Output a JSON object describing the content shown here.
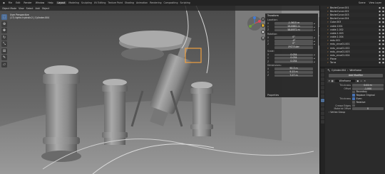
{
  "topbar": {
    "menus": [
      "File",
      "Edit",
      "Render",
      "Window",
      "Help"
    ],
    "workspaces": [
      "Layout",
      "Modeling",
      "Sculpting",
      "UV Editing",
      "Texture Paint",
      "Shading",
      "Animation",
      "Rendering",
      "Compositing",
      "Scripting"
    ],
    "active_workspace": "Layout",
    "scene": "Scene",
    "view_layer": "View Layer"
  },
  "viewport": {
    "mode": "Object Mode",
    "menus": [
      "View",
      "Select",
      "Add",
      "Object"
    ],
    "info_line1": "User Perspective",
    "info_line2": "(17) lights hydrolic2 | Cylinder.004",
    "background_color": "#5d5d5d"
  },
  "npanel": {
    "title": "Transform",
    "location_label": "Location:",
    "location": [
      {
        "axis": "X",
        "value": "-1.5615 m"
      },
      {
        "axis": "Y",
        "value": "28.6681 m"
      },
      {
        "axis": "Z",
        "value": "58.8971 m"
      }
    ],
    "rotation_label": "Rotation:",
    "rotation": [
      {
        "axis": "X",
        "value": "0°"
      },
      {
        "axis": "Y",
        "value": "-0°"
      },
      {
        "axis": "Z",
        "value": "0°"
      }
    ],
    "mode": "XYZ Euler",
    "scale_label": "Scale:",
    "scale": [
      {
        "axis": "X",
        "value": "0.034"
      },
      {
        "axis": "Y",
        "value": "0.034"
      },
      {
        "axis": "Z",
        "value": "0.034"
      }
    ],
    "dimensions_label": "Dimensions:",
    "dimensions": [
      {
        "axis": "X",
        "value": "90.3 m"
      },
      {
        "axis": "Y",
        "value": "9.15 m"
      },
      {
        "axis": "Z",
        "value": "7.07 m"
      }
    ],
    "footer": "Properties"
  },
  "outliner": {
    "rows": [
      {
        "name": "BezierCurve.001"
      },
      {
        "name": "BezierCurve.002"
      },
      {
        "name": "BezierCurve.003"
      },
      {
        "name": "BezierCurve.004"
      },
      {
        "name": "Cube.003"
      },
      {
        "name": "cable.1001"
      },
      {
        "name": "cable.1.002"
      },
      {
        "name": "cable.1.003"
      },
      {
        "name": "cable.1.004"
      },
      {
        "name": "mdu.001"
      },
      {
        "name": "mdu_circa01.001"
      },
      {
        "name": "mdu_circa01.002"
      },
      {
        "name": "mdu_circa01.003"
      },
      {
        "name": "mdu_circa01.004"
      },
      {
        "name": "Plane"
      },
      {
        "name": "Torus"
      }
    ],
    "accent_color": "#e8a050"
  },
  "properties": {
    "object": "Cylinder.004",
    "modifier_tab": "Wireframe",
    "add_modifier": "Add Modifier",
    "modifier_name": "Wireframe",
    "thickness_label": "Thickness",
    "thickness": "0.02 m",
    "offset_label": "Offset",
    "offset": "-1.000",
    "offset_fill": 0.0,
    "checks": [
      {
        "label": "Boundary",
        "on": false
      },
      {
        "label": "Replace Original",
        "on": true
      }
    ],
    "thickness2_label": "Thickness",
    "even_label": "Even",
    "even_on": true,
    "relative_label": "Relative",
    "relative_on": false,
    "crease_label": "Crease Edges",
    "crease_on": false,
    "material_offset_label": "Material Offset",
    "material_offset": "0",
    "vertex_group": "Vertex Group",
    "accent_color": "#4772b3"
  }
}
